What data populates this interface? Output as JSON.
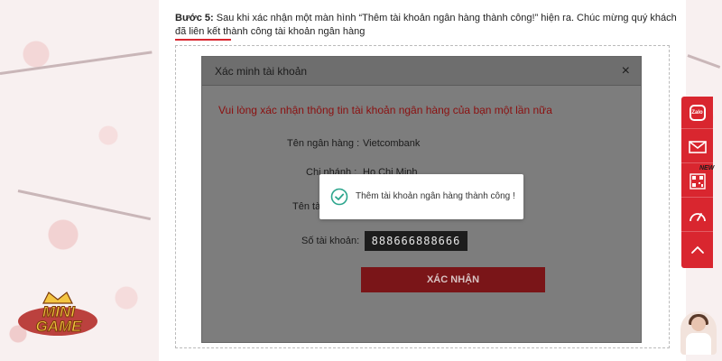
{
  "step": {
    "prefix": "Bước 5:",
    "text": " Sau khi xác nhận một màn hình “Thêm tài khoản ngân hàng thành công!” hiện ra. Chúc mừng quý khách đã liên kết thành công tài khoản ngân hàng"
  },
  "modal": {
    "title": "Xác minh tài khoản",
    "close_icon": "×",
    "warning": "Vui lòng xác nhận thông tin tài khoản ngân hàng của bạn một lần nữa",
    "rows": [
      {
        "label": "Tên ngân hàng :",
        "value": "Vietcombank"
      },
      {
        "label": "Chi nhánh :",
        "value": "Ho Chi Minh"
      },
      {
        "label": "Tên tài khoản :",
        "value": ""
      },
      {
        "label": "Số tài khoản:",
        "value": "888666888666"
      }
    ],
    "confirm_label": "XÁC NHẬN"
  },
  "toast": {
    "message": "Thêm tài khoản ngân hàng thành công !",
    "icon": "check-circle-icon"
  },
  "side_bar": {
    "zalo_label": "Zalo",
    "new_badge": "NEW",
    "items": [
      "zalo-icon",
      "mail-icon",
      "qr-code-icon",
      "speedometer-icon",
      "chevron-up-icon"
    ]
  },
  "logo": {
    "text": "MINI GAME"
  },
  "colors": {
    "accent": "#d9262f",
    "modal_overlay": "#7d7d7d",
    "warning": "#8b1010",
    "success": "#2ca58d"
  }
}
